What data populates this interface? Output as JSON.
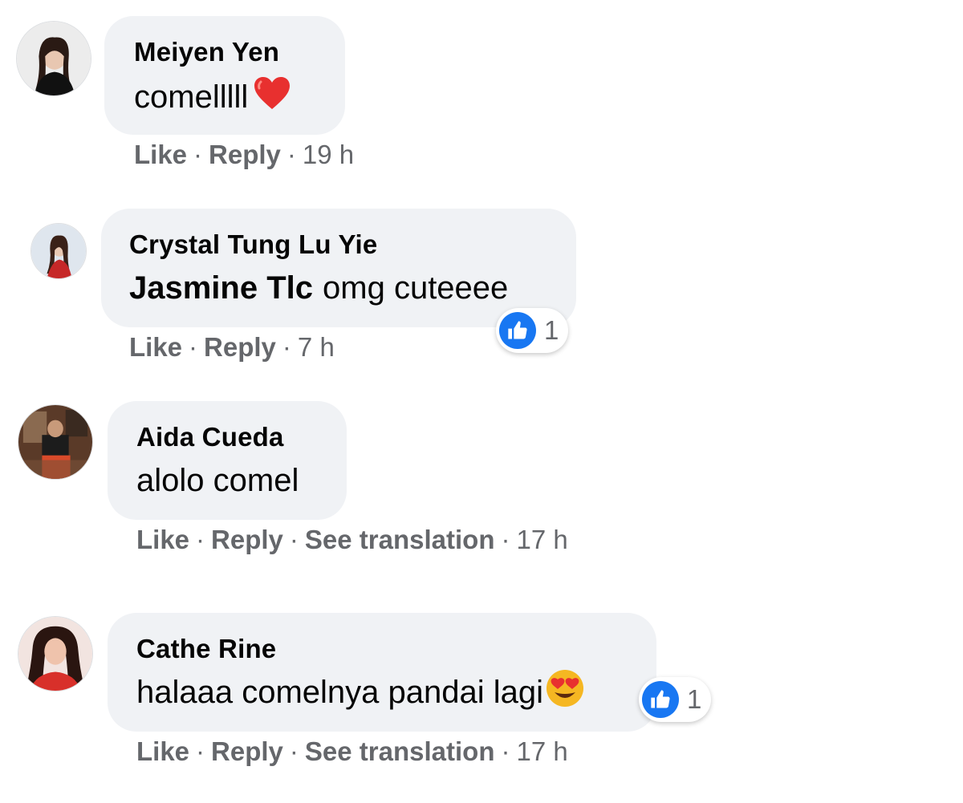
{
  "comments": [
    {
      "author": "Meiyen Yen",
      "mention": "",
      "text": "comelllll",
      "emoji": "heart",
      "actions": {
        "like": "Like",
        "reply": "Reply",
        "translate": "",
        "time": "19 h"
      },
      "reaction_count": ""
    },
    {
      "author": "Crystal Tung Lu Yie",
      "mention": "Jasmine Tlc",
      "text": "omg cuteeee",
      "emoji": "",
      "actions": {
        "like": "Like",
        "reply": "Reply",
        "translate": "",
        "time": "7 h"
      },
      "reaction_count": "1"
    },
    {
      "author": "Aida Cueda",
      "mention": "",
      "text": "alolo comel",
      "emoji": "",
      "actions": {
        "like": "Like",
        "reply": "Reply",
        "translate": "See translation",
        "time": "17 h"
      },
      "reaction_count": ""
    },
    {
      "author": "Cathe Rine",
      "mention": "",
      "text": "halaaa comelnya pandai lagi",
      "emoji": "heart-eyes",
      "actions": {
        "like": "Like",
        "reply": "Reply",
        "translate": "See translation",
        "time": "17 h"
      },
      "reaction_count": "1"
    }
  ],
  "separator": "·",
  "colors": {
    "bubble": "#f0f2f5",
    "meta_text": "#65676b",
    "like_blue": "#1877f2",
    "heart_red": "#e8302f"
  }
}
